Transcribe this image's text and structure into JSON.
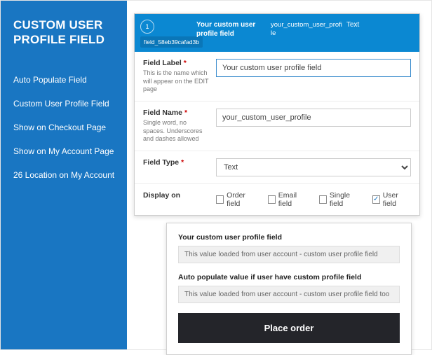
{
  "sidebar": {
    "title_line1": "CUSTOM USER",
    "title_line2": "PROFILE FIELD",
    "items": [
      "Auto Populate Field",
      "Custom User Profile Field",
      "Show on Checkout Page",
      "Show on My Account Page",
      "26 Location on My Account"
    ]
  },
  "editor": {
    "header": {
      "num": "1",
      "tag": "field_58eb39cafad3b",
      "title": "Your custom user profile field",
      "slug": "your_custom_user_profile",
      "type": "Text"
    },
    "label": {
      "title": "Field Label",
      "hint": "This is the name which will appear on the EDIT page",
      "value": "Your custom user profile field"
    },
    "name": {
      "title": "Field Name",
      "hint": "Single word, no spaces. Underscores and dashes allowed",
      "value": "your_custom_user_profile"
    },
    "ftype": {
      "title": "Field Type",
      "value": "Text"
    },
    "display": {
      "title": "Display on",
      "opts": [
        "Order field",
        "Email field",
        "Single field",
        "User field"
      ],
      "checked": 3
    }
  },
  "checkout": {
    "f1": {
      "label": "Your custom user profile field",
      "value": "This value loaded from user account - custom user profile field"
    },
    "f2": {
      "label": "Auto populate value if user have custom profile field",
      "value": "This value loaded from user account - custom user profile field too"
    },
    "btn": "Place order"
  }
}
